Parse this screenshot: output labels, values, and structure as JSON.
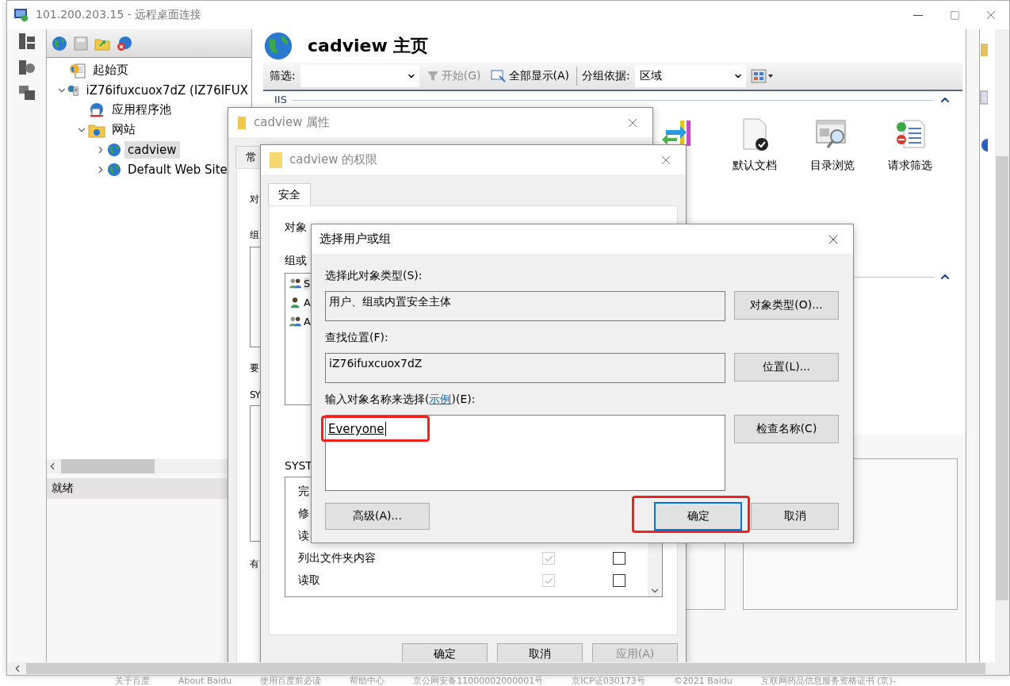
{
  "remote_window": {
    "title": "101.200.203.15 - 远程桌面连接"
  },
  "connections": {
    "tree": [
      {
        "label": "起始页",
        "kind": "start"
      },
      {
        "label": "iZ76ifuxcuox7dZ (IZ76IFUX",
        "kind": "server",
        "expanded": true,
        "children": [
          {
            "label": "应用程序池",
            "kind": "pool"
          },
          {
            "label": "网站",
            "kind": "sites",
            "expanded": true,
            "children": [
              {
                "label": "cadview",
                "kind": "site",
                "expanded": false,
                "selected": true
              },
              {
                "label": "Default Web Site",
                "kind": "site",
                "expanded": false,
                "selected": false
              }
            ]
          }
        ]
      }
    ],
    "status": "就绪"
  },
  "home": {
    "title": "cadview 主页",
    "filter": {
      "label": "筛选:",
      "start": "开始(G)",
      "start_disabled": true,
      "show_all": "全部显示(A)",
      "group_label": "分组依据:",
      "group_value": "区域"
    },
    "section": "IIS",
    "features": [
      {
        "kind": "redirect"
      },
      {
        "kind": "document",
        "label": "默认文档"
      },
      {
        "kind": "browse",
        "label": "目录浏览"
      },
      {
        "kind": "filter",
        "label": "请求筛选"
      }
    ]
  },
  "properties_dialog": {
    "title": "cadview 属性",
    "tab": "常",
    "fragments": [
      "对",
      "组",
      "要",
      "SY",
      "有"
    ]
  },
  "permissions_dialog": {
    "title": "cadview 的权限",
    "tab": "安全",
    "object_label": "对象",
    "group_label": "组或",
    "users": [
      {
        "label": "S",
        "kind": "group",
        "selected": true
      },
      {
        "label": "A",
        "kind": "user",
        "selected": false
      },
      {
        "label": "A",
        "kind": "group",
        "selected": false
      }
    ],
    "permissions_label": "SYST",
    "permissions": [
      {
        "label": "完"
      },
      {
        "label": "修"
      },
      {
        "label": "读"
      },
      {
        "label": "列出文件夹内容",
        "allow": {
          "checked": true,
          "disabled": true
        },
        "deny": {
          "checked": false,
          "disabled": false
        }
      },
      {
        "label": "读取",
        "allow": {
          "checked": true,
          "disabled": true
        },
        "deny": {
          "checked": false,
          "disabled": false
        }
      }
    ],
    "buttons": [
      {
        "label": "确定",
        "disabled": false
      },
      {
        "label": "取消",
        "disabled": false
      },
      {
        "label": "应用(A)",
        "disabled": true
      }
    ]
  },
  "select_dialog": {
    "title": "选择用户或组",
    "object_type_label": "选择此对象类型(S):",
    "object_type": "用户、组或内置安全主体",
    "object_type_button": "对象类型(O)...",
    "location_label": "查找位置(F):",
    "location": "iZ76ifuxcuox7dZ",
    "location_button": "位置(L)...",
    "names_label_before": "输入对象名称来选择(",
    "names_label_link": "示例",
    "names_label_after": ")(E):",
    "names": "Everyone",
    "names_highlighted": true,
    "check_button": "检查名称(C)",
    "advanced_button": "高级(A)...",
    "ok_button": {
      "label": "确定",
      "default": true,
      "highlighted": true
    },
    "cancel_button": "取消"
  },
  "footer": [
    "关于百度",
    "About Baidu",
    "使用百度前必读",
    "帮助中心",
    "京公网安备11000002000001号",
    "京ICP证030173号",
    "©2021 Baidu",
    "互联网药品信息服务资格证书 (京)-"
  ]
}
